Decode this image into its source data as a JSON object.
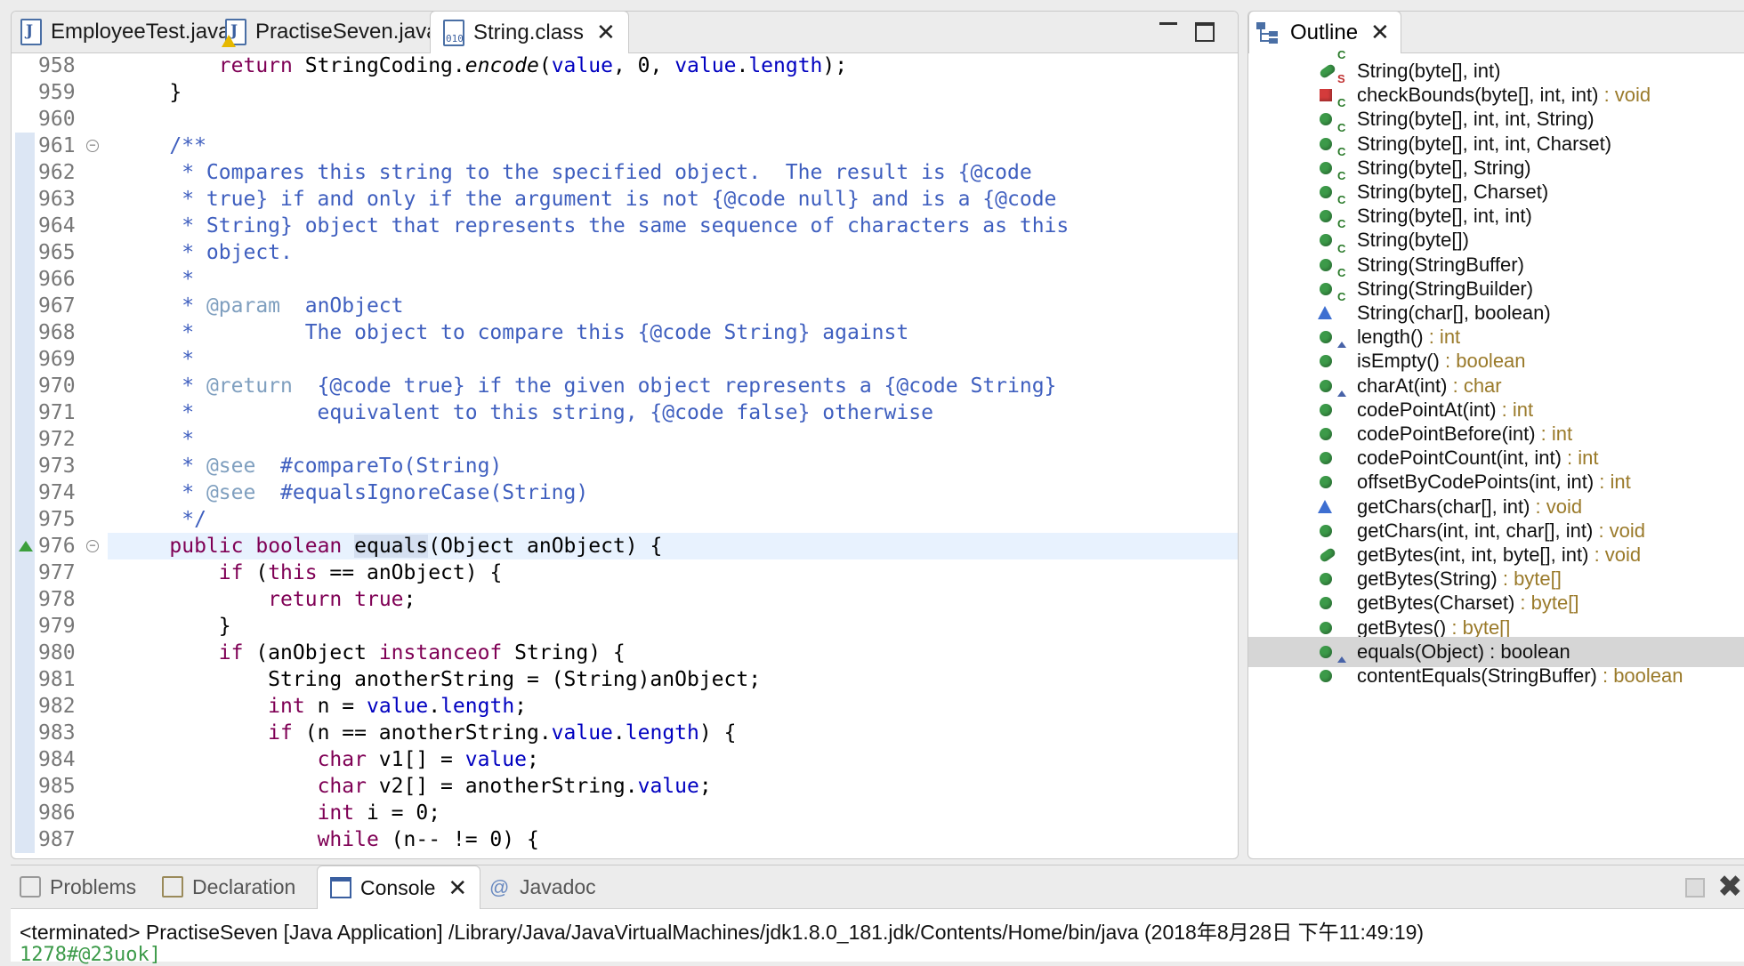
{
  "editor": {
    "tabs": [
      {
        "label": "EmployeeTest.java",
        "icon": "java-file-icon"
      },
      {
        "label": "PractiseSeven.java",
        "icon": "java-file-warning-icon"
      },
      {
        "label": "String.class",
        "icon": "class-file-icon",
        "active": true
      }
    ],
    "lines": [
      {
        "n": "958",
        "html": "        <span class=\"kw\">return</span> StringCoding.<i>encode</i>(<span class=\"fld\">value</span>, 0, <span class=\"fld\">value</span>.<span class=\"fld\">length</span>);"
      },
      {
        "n": "959",
        "html": "    }"
      },
      {
        "n": "960",
        "html": ""
      },
      {
        "n": "961",
        "fold": true,
        "html": "    <span class=\"jd\">/**</span>"
      },
      {
        "n": "962",
        "html": "<span class=\"jd\">     * Compares this string to the specified object.  The result is {@code</span>"
      },
      {
        "n": "963",
        "html": "<span class=\"jd\">     * true} if and only if the argument is not {@code null} and is a {@code</span>"
      },
      {
        "n": "964",
        "html": "<span class=\"jd\">     * String} object that represents the same sequence of characters as this</span>"
      },
      {
        "n": "965",
        "html": "<span class=\"jd\">     * object.</span>"
      },
      {
        "n": "966",
        "html": "<span class=\"jd\">     *</span>"
      },
      {
        "n": "967",
        "html": "<span class=\"jd\">     * </span><span class=\"jt\">@param</span><span class=\"jd\">  anObject</span>"
      },
      {
        "n": "968",
        "html": "<span class=\"jd\">     *         The object to compare this {@code String} against</span>"
      },
      {
        "n": "969",
        "html": "<span class=\"jd\">     *</span>"
      },
      {
        "n": "970",
        "html": "<span class=\"jd\">     * </span><span class=\"jt\">@return</span><span class=\"jd\">  {@code true} if the given object represents a {@code String}</span>"
      },
      {
        "n": "971",
        "html": "<span class=\"jd\">     *          equivalent to this string, {@code false} otherwise</span>"
      },
      {
        "n": "972",
        "html": "<span class=\"jd\">     *</span>"
      },
      {
        "n": "973",
        "html": "<span class=\"jd\">     * </span><span class=\"jt\">@see</span><span class=\"jd\">  #compareTo(String)</span>"
      },
      {
        "n": "974",
        "html": "<span class=\"jd\">     * </span><span class=\"jt\">@see</span><span class=\"jd\">  #equalsIgnoreCase(String)</span>"
      },
      {
        "n": "975",
        "html": "<span class=\"jd\">     */</span>"
      },
      {
        "n": "976",
        "fold": true,
        "override": true,
        "current": true,
        "html": "    <span class=\"kw\">public</span> <span class=\"kw\">boolean</span> <span class=\"hl\">equals</span>(Object anObject) {"
      },
      {
        "n": "977",
        "html": "        <span class=\"kw\">if</span> (<span class=\"kw\">this</span> == anObject) {"
      },
      {
        "n": "978",
        "html": "            <span class=\"kw\">return</span> <span class=\"kw\">true</span>;"
      },
      {
        "n": "979",
        "html": "        }"
      },
      {
        "n": "980",
        "html": "        <span class=\"kw\">if</span> (anObject <span class=\"kw\">instanceof</span> String) {"
      },
      {
        "n": "981",
        "html": "            String anotherString = (String)anObject;"
      },
      {
        "n": "982",
        "html": "            <span class=\"kw\">int</span> n = <span class=\"fld\">value</span>.<span class=\"fld\">length</span>;"
      },
      {
        "n": "983",
        "html": "            <span class=\"kw\">if</span> (n == anotherString.<span class=\"fld\">value</span>.<span class=\"fld\">length</span>) {"
      },
      {
        "n": "984",
        "html": "                <span class=\"kw\">char</span> v1[] = <span class=\"fld\">value</span>;"
      },
      {
        "n": "985",
        "html": "                <span class=\"kw\">char</span> v2[] = anotherString.<span class=\"fld\">value</span>;"
      },
      {
        "n": "986",
        "html": "                <span class=\"kw\">int</span> i = 0;"
      },
      {
        "n": "987",
        "html": "                <span class=\"kw\">while</span> (n-- != 0) {"
      }
    ]
  },
  "outline": {
    "title": "Outline",
    "items": [
      {
        "name": "String(byte[], int)",
        "type": "",
        "vis": "hint",
        "mods": "C"
      },
      {
        "name": "checkBounds(byte[], int, int)",
        "type": " : void",
        "vis": "priv",
        "mods": "S"
      },
      {
        "name": "String(byte[], int, int, String)",
        "type": "",
        "vis": "pub",
        "mods": "C"
      },
      {
        "name": "String(byte[], int, int, Charset)",
        "type": "",
        "vis": "pub",
        "mods": "C"
      },
      {
        "name": "String(byte[], String)",
        "type": "",
        "vis": "pub",
        "mods": "C"
      },
      {
        "name": "String(byte[], Charset)",
        "type": "",
        "vis": "pub",
        "mods": "C"
      },
      {
        "name": "String(byte[], int, int)",
        "type": "",
        "vis": "pub",
        "mods": "C"
      },
      {
        "name": "String(byte[])",
        "type": "",
        "vis": "pub",
        "mods": "C"
      },
      {
        "name": "String(StringBuffer)",
        "type": "",
        "vis": "pub",
        "mods": "C"
      },
      {
        "name": "String(StringBuilder)",
        "type": "",
        "vis": "pub",
        "mods": "C"
      },
      {
        "name": "String(char[], boolean)",
        "type": "",
        "vis": "pkg",
        "mods": "C"
      },
      {
        "name": "length()",
        "type": " : int",
        "vis": "pub",
        "mods": "",
        "implements": true
      },
      {
        "name": "isEmpty()",
        "type": " : boolean",
        "vis": "pub",
        "mods": ""
      },
      {
        "name": "charAt(int)",
        "type": " : char",
        "vis": "pub",
        "mods": "",
        "implements": true
      },
      {
        "name": "codePointAt(int)",
        "type": " : int",
        "vis": "pub",
        "mods": ""
      },
      {
        "name": "codePointBefore(int)",
        "type": " : int",
        "vis": "pub",
        "mods": ""
      },
      {
        "name": "codePointCount(int, int)",
        "type": " : int",
        "vis": "pub",
        "mods": ""
      },
      {
        "name": "offsetByCodePoints(int, int)",
        "type": " : int",
        "vis": "pub",
        "mods": ""
      },
      {
        "name": "getChars(char[], int)",
        "type": " : void",
        "vis": "pkg",
        "mods": ""
      },
      {
        "name": "getChars(int, int, char[], int)",
        "type": " : void",
        "vis": "pub",
        "mods": ""
      },
      {
        "name": "getBytes(int, int, byte[], int)",
        "type": " : void",
        "vis": "hint",
        "mods": ""
      },
      {
        "name": "getBytes(String)",
        "type": " : byte[]",
        "vis": "pub",
        "mods": ""
      },
      {
        "name": "getBytes(Charset)",
        "type": " : byte[]",
        "vis": "pub",
        "mods": ""
      },
      {
        "name": "getBytes()",
        "type": " : byte[]",
        "vis": "pub",
        "mods": ""
      },
      {
        "name": "equals(Object) : boolean",
        "type": "",
        "vis": "pub",
        "mods": "",
        "implements": true,
        "selected": true
      },
      {
        "name": "contentEquals(StringBuffer)",
        "type": " : boolean",
        "vis": "pub",
        "mods": ""
      }
    ]
  },
  "console": {
    "tabs": [
      {
        "label": "Problems",
        "icon": "problems-icon"
      },
      {
        "label": "Declaration",
        "icon": "declaration-icon"
      },
      {
        "label": "Console",
        "icon": "console-icon",
        "active": true
      },
      {
        "label": "Javadoc",
        "icon": "javadoc-icon"
      }
    ],
    "status": "<terminated> PractiseSeven [Java Application] /Library/Java/JavaVirtualMachines/jdk1.8.0_181.jdk/Contents/Home/bin/java (2018年8月28日 下午11:49:19)",
    "output": "1278#@23uok]"
  },
  "colors": {
    "keyword": "#7f0055",
    "javadoc": "#3f5fbf",
    "field": "#0000c0",
    "public_method": "#3c9a49"
  }
}
